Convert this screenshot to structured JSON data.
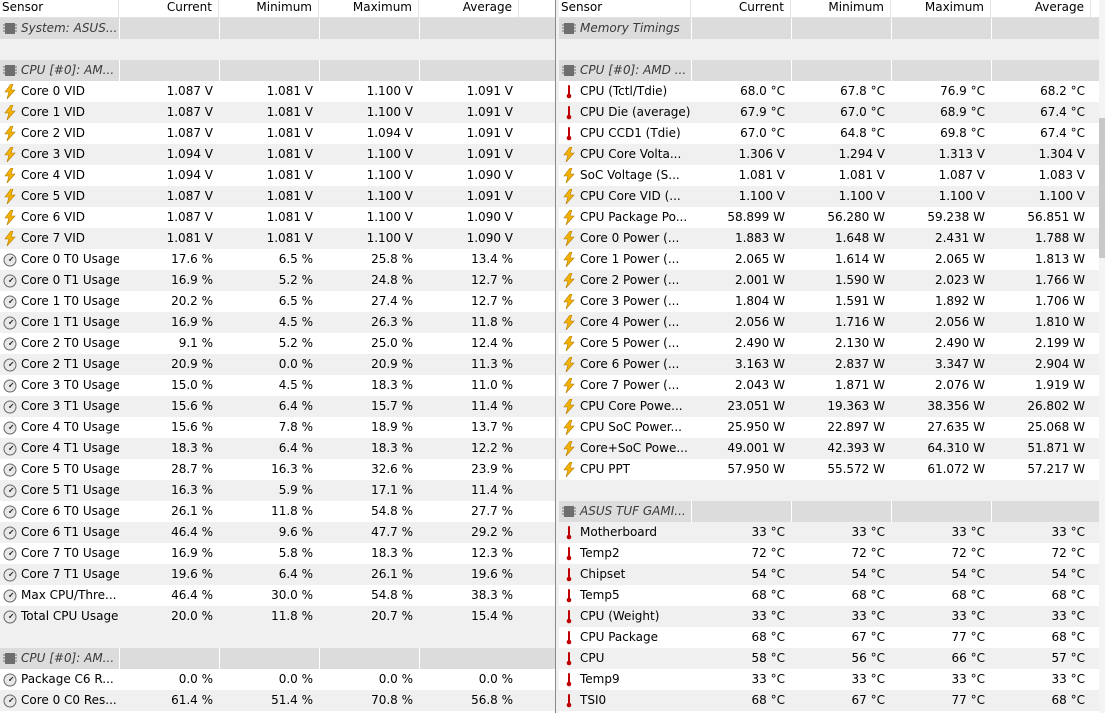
{
  "left": {
    "columns": [
      "Sensor",
      "Current",
      "Minimum",
      "Maximum",
      "Average"
    ],
    "rows": [
      {
        "kind": "group",
        "icon": "chip-icon",
        "name": "System: ASUS..."
      },
      {
        "kind": "empty"
      },
      {
        "kind": "group",
        "icon": "chip-icon",
        "name": "CPU [#0]: AM..."
      },
      {
        "kind": "sensor",
        "icon": "voltage-bolt-icon",
        "name": "Core 0 VID",
        "cur": "1.087 V",
        "min": "1.081 V",
        "max": "1.100 V",
        "avg": "1.091 V"
      },
      {
        "kind": "sensor",
        "icon": "voltage-bolt-icon",
        "name": "Core 1 VID",
        "cur": "1.087 V",
        "min": "1.081 V",
        "max": "1.100 V",
        "avg": "1.091 V"
      },
      {
        "kind": "sensor",
        "icon": "voltage-bolt-icon",
        "name": "Core 2 VID",
        "cur": "1.087 V",
        "min": "1.081 V",
        "max": "1.094 V",
        "avg": "1.091 V"
      },
      {
        "kind": "sensor",
        "icon": "voltage-bolt-icon",
        "name": "Core 3 VID",
        "cur": "1.094 V",
        "min": "1.081 V",
        "max": "1.100 V",
        "avg": "1.091 V"
      },
      {
        "kind": "sensor",
        "icon": "voltage-bolt-icon",
        "name": "Core 4 VID",
        "cur": "1.094 V",
        "min": "1.081 V",
        "max": "1.100 V",
        "avg": "1.090 V"
      },
      {
        "kind": "sensor",
        "icon": "voltage-bolt-icon",
        "name": "Core 5 VID",
        "cur": "1.087 V",
        "min": "1.081 V",
        "max": "1.100 V",
        "avg": "1.091 V"
      },
      {
        "kind": "sensor",
        "icon": "voltage-bolt-icon",
        "name": "Core 6 VID",
        "cur": "1.087 V",
        "min": "1.081 V",
        "max": "1.100 V",
        "avg": "1.090 V"
      },
      {
        "kind": "sensor",
        "icon": "voltage-bolt-icon",
        "name": "Core 7 VID",
        "cur": "1.081 V",
        "min": "1.081 V",
        "max": "1.100 V",
        "avg": "1.090 V"
      },
      {
        "kind": "sensor",
        "icon": "usage-gauge-icon",
        "name": "Core 0 T0 Usage",
        "cur": "17.6 %",
        "min": "6.5 %",
        "max": "25.8 %",
        "avg": "13.4 %"
      },
      {
        "kind": "sensor",
        "icon": "usage-gauge-icon",
        "name": "Core 0 T1 Usage",
        "cur": "16.9 %",
        "min": "5.2 %",
        "max": "24.8 %",
        "avg": "12.7 %"
      },
      {
        "kind": "sensor",
        "icon": "usage-gauge-icon",
        "name": "Core 1 T0 Usage",
        "cur": "20.2 %",
        "min": "6.5 %",
        "max": "27.4 %",
        "avg": "12.7 %"
      },
      {
        "kind": "sensor",
        "icon": "usage-gauge-icon",
        "name": "Core 1 T1 Usage",
        "cur": "16.9 %",
        "min": "4.5 %",
        "max": "26.3 %",
        "avg": "11.8 %"
      },
      {
        "kind": "sensor",
        "icon": "usage-gauge-icon",
        "name": "Core 2 T0 Usage",
        "cur": "9.1 %",
        "min": "5.2 %",
        "max": "25.0 %",
        "avg": "12.4 %"
      },
      {
        "kind": "sensor",
        "icon": "usage-gauge-icon",
        "name": "Core 2 T1 Usage",
        "cur": "20.9 %",
        "min": "0.0 %",
        "max": "20.9 %",
        "avg": "11.3 %"
      },
      {
        "kind": "sensor",
        "icon": "usage-gauge-icon",
        "name": "Core 3 T0 Usage",
        "cur": "15.0 %",
        "min": "4.5 %",
        "max": "18.3 %",
        "avg": "11.0 %"
      },
      {
        "kind": "sensor",
        "icon": "usage-gauge-icon",
        "name": "Core 3 T1 Usage",
        "cur": "15.6 %",
        "min": "6.4 %",
        "max": "15.7 %",
        "avg": "11.4 %"
      },
      {
        "kind": "sensor",
        "icon": "usage-gauge-icon",
        "name": "Core 4 T0 Usage",
        "cur": "15.6 %",
        "min": "7.8 %",
        "max": "18.9 %",
        "avg": "13.7 %"
      },
      {
        "kind": "sensor",
        "icon": "usage-gauge-icon",
        "name": "Core 4 T1 Usage",
        "cur": "18.3 %",
        "min": "6.4 %",
        "max": "18.3 %",
        "avg": "12.2 %"
      },
      {
        "kind": "sensor",
        "icon": "usage-gauge-icon",
        "name": "Core 5 T0 Usage",
        "cur": "28.7 %",
        "min": "16.3 %",
        "max": "32.6 %",
        "avg": "23.9 %"
      },
      {
        "kind": "sensor",
        "icon": "usage-gauge-icon",
        "name": "Core 5 T1 Usage",
        "cur": "16.3 %",
        "min": "5.9 %",
        "max": "17.1 %",
        "avg": "11.4 %"
      },
      {
        "kind": "sensor",
        "icon": "usage-gauge-icon",
        "name": "Core 6 T0 Usage",
        "cur": "26.1 %",
        "min": "11.8 %",
        "max": "54.8 %",
        "avg": "27.7 %"
      },
      {
        "kind": "sensor",
        "icon": "usage-gauge-icon",
        "name": "Core 6 T1 Usage",
        "cur": "46.4 %",
        "min": "9.6 %",
        "max": "47.7 %",
        "avg": "29.2 %"
      },
      {
        "kind": "sensor",
        "icon": "usage-gauge-icon",
        "name": "Core 7 T0 Usage",
        "cur": "16.9 %",
        "min": "5.8 %",
        "max": "18.3 %",
        "avg": "12.3 %"
      },
      {
        "kind": "sensor",
        "icon": "usage-gauge-icon",
        "name": "Core 7 T1 Usage",
        "cur": "19.6 %",
        "min": "6.4 %",
        "max": "26.1 %",
        "avg": "19.6 %"
      },
      {
        "kind": "sensor",
        "icon": "usage-gauge-icon",
        "name": "Max CPU/Thre...",
        "cur": "46.4 %",
        "min": "30.0 %",
        "max": "54.8 %",
        "avg": "38.3 %"
      },
      {
        "kind": "sensor",
        "icon": "usage-gauge-icon",
        "name": "Total CPU Usage",
        "cur": "20.0 %",
        "min": "11.8 %",
        "max": "20.7 %",
        "avg": "15.4 %"
      },
      {
        "kind": "empty"
      },
      {
        "kind": "group",
        "icon": "chip-icon",
        "name": "CPU [#0]: AM..."
      },
      {
        "kind": "sensor",
        "icon": "usage-gauge-icon",
        "name": "Package C6 R...",
        "cur": "0.0 %",
        "min": "0.0 %",
        "max": "0.0 %",
        "avg": "0.0 %"
      },
      {
        "kind": "sensor",
        "icon": "usage-gauge-icon",
        "name": "Core 0 C0 Res...",
        "cur": "61.4 %",
        "min": "51.4 %",
        "max": "70.8 %",
        "avg": "56.8 %"
      }
    ]
  },
  "right": {
    "columns": [
      "Sensor",
      "Current",
      "Minimum",
      "Maximum",
      "Average"
    ],
    "rows": [
      {
        "kind": "group",
        "icon": "chip-icon",
        "name": "Memory Timings"
      },
      {
        "kind": "empty"
      },
      {
        "kind": "group",
        "icon": "chip-icon",
        "name": "CPU [#0]: AMD ..."
      },
      {
        "kind": "sensor",
        "icon": "thermometer-icon",
        "name": "CPU (Tctl/Tdie)",
        "cur": "68.0 °C",
        "min": "67.8 °C",
        "max": "76.9 °C",
        "avg": "68.2 °C"
      },
      {
        "kind": "sensor",
        "icon": "thermometer-icon",
        "name": "CPU Die (average)",
        "cur": "67.9 °C",
        "min": "67.0 °C",
        "max": "68.9 °C",
        "avg": "67.4 °C"
      },
      {
        "kind": "sensor",
        "icon": "thermometer-icon",
        "name": "CPU CCD1 (Tdie)",
        "cur": "67.0 °C",
        "min": "64.8 °C",
        "max": "69.8 °C",
        "avg": "67.4 °C"
      },
      {
        "kind": "sensor",
        "icon": "voltage-bolt-icon",
        "name": "CPU Core Volta...",
        "cur": "1.306 V",
        "min": "1.294 V",
        "max": "1.313 V",
        "avg": "1.304 V"
      },
      {
        "kind": "sensor",
        "icon": "voltage-bolt-icon",
        "name": "SoC Voltage (S...",
        "cur": "1.081 V",
        "min": "1.081 V",
        "max": "1.087 V",
        "avg": "1.083 V"
      },
      {
        "kind": "sensor",
        "icon": "voltage-bolt-icon",
        "name": "CPU Core VID (...",
        "cur": "1.100 V",
        "min": "1.100 V",
        "max": "1.100 V",
        "avg": "1.100 V"
      },
      {
        "kind": "sensor",
        "icon": "voltage-bolt-icon",
        "name": "CPU Package Po...",
        "cur": "58.899 W",
        "min": "56.280 W",
        "max": "59.238 W",
        "avg": "56.851 W"
      },
      {
        "kind": "sensor",
        "icon": "voltage-bolt-icon",
        "name": "Core 0 Power (...",
        "cur": "1.883 W",
        "min": "1.648 W",
        "max": "2.431 W",
        "avg": "1.788 W"
      },
      {
        "kind": "sensor",
        "icon": "voltage-bolt-icon",
        "name": "Core 1 Power (...",
        "cur": "2.065 W",
        "min": "1.614 W",
        "max": "2.065 W",
        "avg": "1.813 W"
      },
      {
        "kind": "sensor",
        "icon": "voltage-bolt-icon",
        "name": "Core 2 Power (...",
        "cur": "2.001 W",
        "min": "1.590 W",
        "max": "2.023 W",
        "avg": "1.766 W"
      },
      {
        "kind": "sensor",
        "icon": "voltage-bolt-icon",
        "name": "Core 3 Power (...",
        "cur": "1.804 W",
        "min": "1.591 W",
        "max": "1.892 W",
        "avg": "1.706 W"
      },
      {
        "kind": "sensor",
        "icon": "voltage-bolt-icon",
        "name": "Core 4 Power (...",
        "cur": "2.056 W",
        "min": "1.716 W",
        "max": "2.056 W",
        "avg": "1.810 W"
      },
      {
        "kind": "sensor",
        "icon": "voltage-bolt-icon",
        "name": "Core 5 Power (...",
        "cur": "2.490 W",
        "min": "2.130 W",
        "max": "2.490 W",
        "avg": "2.199 W"
      },
      {
        "kind": "sensor",
        "icon": "voltage-bolt-icon",
        "name": "Core 6 Power (...",
        "cur": "3.163 W",
        "min": "2.837 W",
        "max": "3.347 W",
        "avg": "2.904 W"
      },
      {
        "kind": "sensor",
        "icon": "voltage-bolt-icon",
        "name": "Core 7 Power (...",
        "cur": "2.043 W",
        "min": "1.871 W",
        "max": "2.076 W",
        "avg": "1.919 W"
      },
      {
        "kind": "sensor",
        "icon": "voltage-bolt-icon",
        "name": "CPU Core Powe...",
        "cur": "23.051 W",
        "min": "19.363 W",
        "max": "38.356 W",
        "avg": "26.802 W"
      },
      {
        "kind": "sensor",
        "icon": "voltage-bolt-icon",
        "name": "CPU SoC Power...",
        "cur": "25.950 W",
        "min": "22.897 W",
        "max": "27.635 W",
        "avg": "25.068 W"
      },
      {
        "kind": "sensor",
        "icon": "voltage-bolt-icon",
        "name": "Core+SoC Powe...",
        "cur": "49.001 W",
        "min": "42.393 W",
        "max": "64.310 W",
        "avg": "51.871 W"
      },
      {
        "kind": "sensor",
        "icon": "voltage-bolt-icon",
        "name": "CPU PPT",
        "cur": "57.950 W",
        "min": "55.572 W",
        "max": "61.072 W",
        "avg": "57.217 W"
      },
      {
        "kind": "empty"
      },
      {
        "kind": "group",
        "icon": "chip-icon",
        "name": "ASUS TUF GAMI..."
      },
      {
        "kind": "sensor",
        "icon": "thermometer-icon",
        "name": "Motherboard",
        "cur": "33 °C",
        "min": "33 °C",
        "max": "33 °C",
        "avg": "33 °C"
      },
      {
        "kind": "sensor",
        "icon": "thermometer-icon",
        "name": "Temp2",
        "cur": "72 °C",
        "min": "72 °C",
        "max": "72 °C",
        "avg": "72 °C"
      },
      {
        "kind": "sensor",
        "icon": "thermometer-icon",
        "name": "Chipset",
        "cur": "54 °C",
        "min": "54 °C",
        "max": "54 °C",
        "avg": "54 °C"
      },
      {
        "kind": "sensor",
        "icon": "thermometer-icon",
        "name": "Temp5",
        "cur": "68 °C",
        "min": "68 °C",
        "max": "68 °C",
        "avg": "68 °C"
      },
      {
        "kind": "sensor",
        "icon": "thermometer-icon",
        "name": "CPU (Weight)",
        "cur": "33 °C",
        "min": "33 °C",
        "max": "33 °C",
        "avg": "33 °C"
      },
      {
        "kind": "sensor",
        "icon": "thermometer-icon",
        "name": "CPU Package",
        "cur": "68 °C",
        "min": "67 °C",
        "max": "77 °C",
        "avg": "68 °C"
      },
      {
        "kind": "sensor",
        "icon": "thermometer-icon",
        "name": "CPU",
        "cur": "58 °C",
        "min": "56 °C",
        "max": "66 °C",
        "avg": "57 °C"
      },
      {
        "kind": "sensor",
        "icon": "thermometer-icon",
        "name": "Temp9",
        "cur": "33 °C",
        "min": "33 °C",
        "max": "33 °C",
        "avg": "33 °C"
      },
      {
        "kind": "sensor",
        "icon": "thermometer-icon",
        "name": "TSI0",
        "cur": "68 °C",
        "min": "67 °C",
        "max": "77 °C",
        "avg": "68 °C"
      }
    ]
  },
  "colors": {
    "row_shade": "#f0f0f0",
    "group_bg": "#dcdcdc",
    "bolt_fill": "#f5b301",
    "thermo_red": "#c00000",
    "chip_gray": "#6e6e6e"
  }
}
